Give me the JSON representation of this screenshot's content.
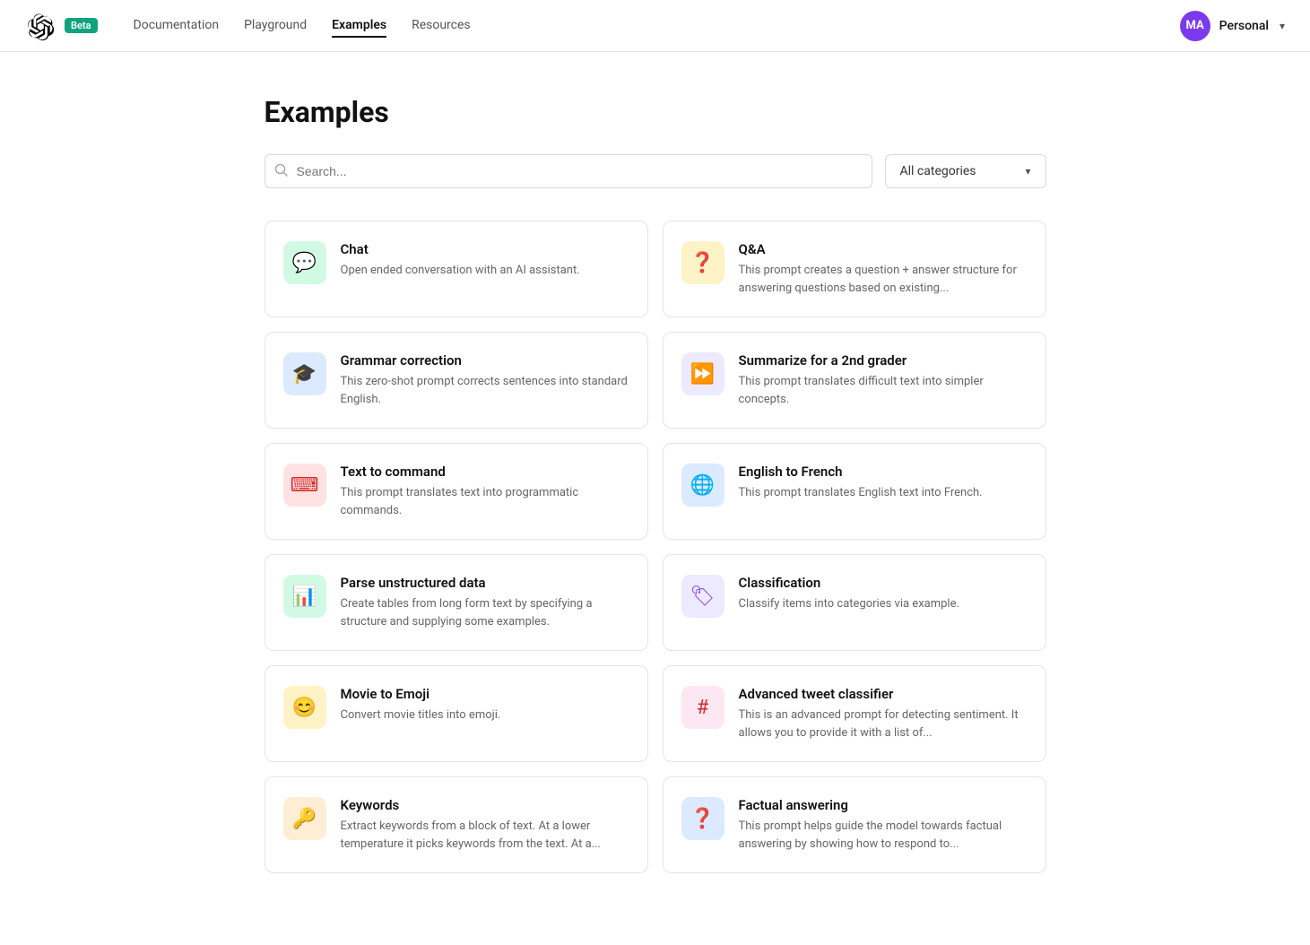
{
  "nav": {
    "logo_alt": "OpenAI",
    "beta_label": "Beta",
    "links": [
      {
        "id": "documentation",
        "label": "Documentation",
        "active": false
      },
      {
        "id": "playground",
        "label": "Playground",
        "active": false
      },
      {
        "id": "examples",
        "label": "Examples",
        "active": true
      },
      {
        "id": "resources",
        "label": "Resources",
        "active": false
      }
    ],
    "user_initials": "MA",
    "username": "Personal",
    "chevron": "▾"
  },
  "page": {
    "title": "Examples"
  },
  "search": {
    "placeholder": "Search..."
  },
  "category": {
    "label": "All categories",
    "chevron": "▾"
  },
  "cards": [
    {
      "id": "chat",
      "title": "Chat",
      "desc": "Open ended conversation with an AI assistant.",
      "icon": "💬",
      "icon_class": "bg-green-light icon-chat"
    },
    {
      "id": "qa",
      "title": "Q&A",
      "desc": "This prompt creates a question + answer structure for answering questions based on existing...",
      "icon": "❓",
      "icon_class": "bg-yellow-light icon-qa"
    },
    {
      "id": "grammar-correction",
      "title": "Grammar correction",
      "desc": "This zero-shot prompt corrects sentences into standard English.",
      "icon": "🎓",
      "icon_class": "bg-blue-light icon-grammar"
    },
    {
      "id": "summarize",
      "title": "Summarize for a 2nd grader",
      "desc": "This prompt translates difficult text into simpler concepts.",
      "icon": "⏩",
      "icon_class": "bg-purple-light icon-summarize"
    },
    {
      "id": "text-to-command",
      "title": "Text to command",
      "desc": "This prompt translates text into programmatic commands.",
      "icon": "⌨",
      "icon_class": "bg-red-light icon-cmd"
    },
    {
      "id": "english-to-french",
      "title": "English to French",
      "desc": "This prompt translates English text into French.",
      "icon": "🌐",
      "icon_class": "bg-blue-light icon-lang"
    },
    {
      "id": "parse-unstructured-data",
      "title": "Parse unstructured data",
      "desc": "Create tables from long form text by specifying a structure and supplying some examples.",
      "icon": "📊",
      "icon_class": "bg-green-light icon-parse"
    },
    {
      "id": "classification",
      "title": "Classification",
      "desc": "Classify items into categories via example.",
      "icon": "🏷",
      "icon_class": "bg-purple-light icon-classify"
    },
    {
      "id": "movie-to-emoji",
      "title": "Movie to Emoji",
      "desc": "Convert movie titles into emoji.",
      "icon": "😊",
      "icon_class": "bg-yellow-light icon-emoji"
    },
    {
      "id": "advanced-tweet-classifier",
      "title": "Advanced tweet classifier",
      "desc": "This is an advanced prompt for detecting sentiment. It allows you to provide it with a list of...",
      "icon": "#",
      "icon_class": "bg-pink-light icon-tweet"
    },
    {
      "id": "keywords",
      "title": "Keywords",
      "desc": "Extract keywords from a block of text. At a lower temperature it picks keywords from the text. At a...",
      "icon": "🔑",
      "icon_class": "bg-orange-light icon-keywords"
    },
    {
      "id": "factual-answering",
      "title": "Factual answering",
      "desc": "This prompt helps guide the model towards factual answering by showing how to respond to...",
      "icon": "❓",
      "icon_class": "bg-blue-light icon-factual"
    }
  ]
}
